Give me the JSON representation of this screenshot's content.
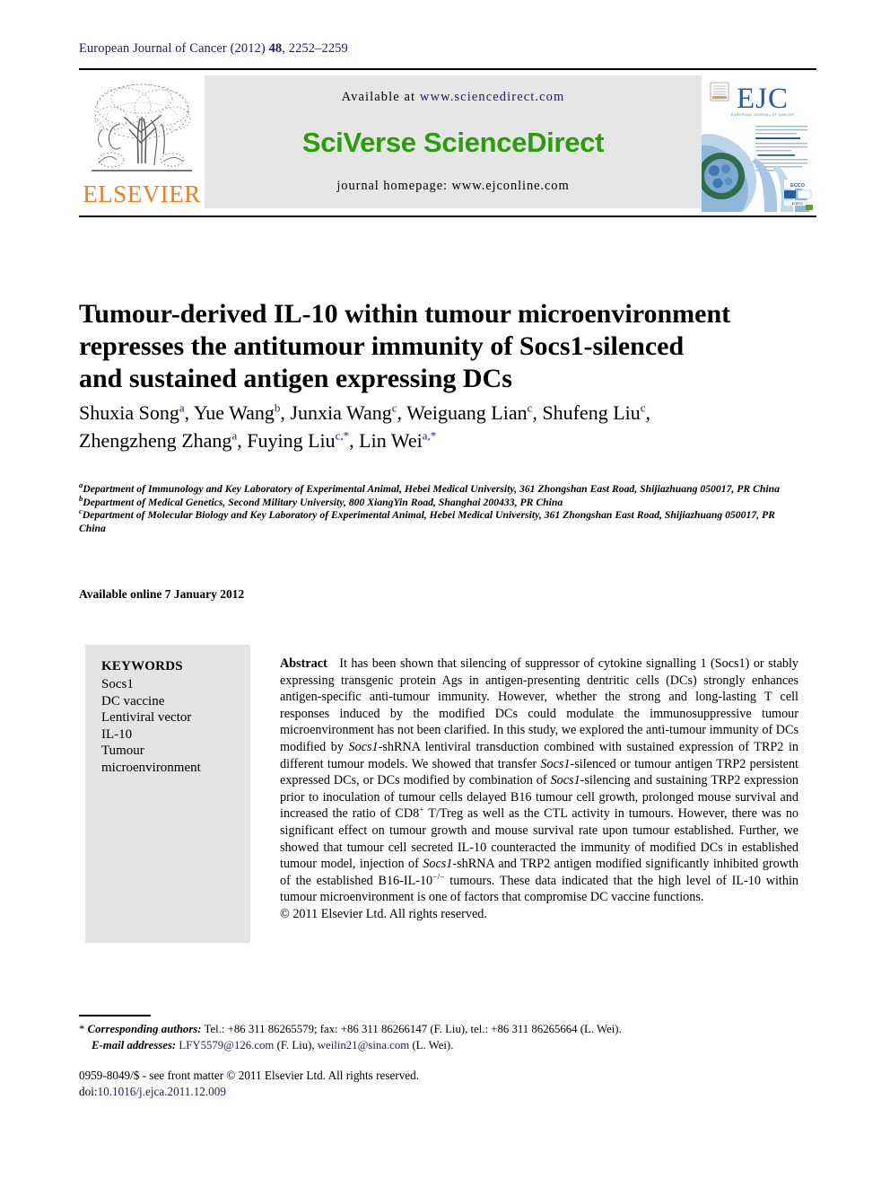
{
  "running_head": {
    "journal": "European Journal of Cancer (2012)",
    "volume": "48",
    "pages": ", 2252–2259"
  },
  "banner": {
    "elsevier_wordmark": "ELSEVIER",
    "available_prefix": "Available at ",
    "available_url": "www.sciencedirect.com",
    "sciverse": "SciVerse ScienceDirect",
    "homepage": "journal homepage: www.ejconline.com",
    "cover_title": "EJC",
    "cover_subtitle": "EUROPEAN JOURNAL OF CANCER"
  },
  "article": {
    "title_line1": "Tumour-derived IL-10 within tumour microenvironment",
    "title_line2": "represses the antitumour immunity of Socs1-silenced",
    "title_line3": "and sustained antigen expressing DCs",
    "available_online": "Available online 7 January 2012"
  },
  "authors": {
    "line1": [
      {
        "name": "Shuxia Song",
        "sup": "a",
        "sep": ", "
      },
      {
        "name": "Yue Wang",
        "sup": "b",
        "sep": ", "
      },
      {
        "name": "Junxia Wang",
        "sup": "c",
        "sep": ", "
      },
      {
        "name": "Weiguang Lian",
        "sup": "c",
        "sep": ", "
      },
      {
        "name": "Shufeng Liu",
        "sup": "c",
        "sep": ","
      }
    ],
    "line2": [
      {
        "name": "Zhengzheng Zhang",
        "sup": "a",
        "sep": ", "
      },
      {
        "name": "Fuying Liu",
        "sup": "c,*",
        "sep": ", "
      },
      {
        "name": "Lin Wei",
        "sup": "a,*",
        "sep": ""
      }
    ]
  },
  "affiliations": [
    {
      "mark": "a",
      "text": "Department of Immunology and Key Laboratory of Experimental Animal, Hebei Medical University, 361 Zhongshan East Road, Shijiazhuang 050017, PR China"
    },
    {
      "mark": "b",
      "text": "Department of Medical Genetics, Second Military University, 800 XiangYin Road, Shanghai 200433, PR China"
    },
    {
      "mark": "c",
      "text": "Department of Molecular Biology and Key Laboratory of Experimental Animal, Hebei Medical University, 361 Zhongshan East Road, Shijiazhuang 050017, PR China"
    }
  ],
  "keywords": {
    "heading": "KEYWORDS",
    "items": [
      "Socs1",
      "DC vaccine",
      "Lentiviral vector",
      "IL-10",
      "Tumour",
      "microenvironment"
    ]
  },
  "abstract": {
    "label": "Abstract",
    "body_parts": [
      {
        "t": "It has been shown that silencing of suppressor of cytokine signalling 1 (Socs1) or stably expressing transgenic protein Ags in antigen-presenting dentritic cells (DCs) strongly enhances antigen-specific anti-tumour immunity. However, whether the strong and long-lasting T cell responses induced by the modified DCs could modulate the immunosuppressive tumour microenvironment has not been clarified. In this study, we explored the anti-tumour immunity of DCs modified by "
      },
      {
        "t": "Socs1",
        "i": true
      },
      {
        "t": "-shRNA lentiviral transduction combined with sustained expression of TRP2 in different tumour models. We showed that transfer "
      },
      {
        "t": "Socs1",
        "i": true
      },
      {
        "t": "-silenced or tumour antigen TRP2 persistent expressed DCs, or DCs modified by combination of "
      },
      {
        "t": "Socs1",
        "i": true
      },
      {
        "t": "-silencing and sustaining TRP2 expression prior to inoculation of tumour cells delayed B16 tumour cell growth, prolonged mouse survival and increased the ratio of CD8"
      },
      {
        "t": "+",
        "sup": true
      },
      {
        "t": " T/Treg as well as the CTL activity in tumours. However, there was no significant effect on tumour growth and mouse survival rate upon tumour established. Further, we showed that tumour cell secreted IL-10 counteracted the immunity of modified DCs in established tumour model, injection of "
      },
      {
        "t": "Socs1",
        "i": true
      },
      {
        "t": "-shRNA and TRP2 antigen modified significantly inhibited growth of the established B16-IL-10"
      },
      {
        "t": "−/−",
        "sup": true
      },
      {
        "t": " tumours. These data indicated that the high level of IL-10 within tumour microenvironment is one of factors that compromise DC vaccine functions."
      }
    ],
    "copyright": "© 2011 Elsevier Ltd. All rights reserved."
  },
  "footnote": {
    "star": "*",
    "corresponding_label": "Corresponding authors:",
    "corresponding_text": " Tel.: +86 311 86265579; fax: +86 311 86266147 (F. Liu), tel.: +86 311 86265664 (L. Wei).",
    "email_label": "E-mail addresses:",
    "email1": "LFY5579@126.com",
    "email1_owner": " (F. Liu), ",
    "email2": "weilin21@sina.com",
    "email2_owner": " (L. Wei)."
  },
  "bottom": {
    "issn_line": "0959-8049/$ - see front matter © 2011 Elsevier Ltd. All rights reserved.",
    "doi_prefix": "doi:",
    "doi_value": "10.1016/j.ejca.2011.12.009"
  },
  "colors": {
    "navy": "#1d1d66",
    "elsevier_orange": "#f07d20",
    "sciencedirect_green": "#2a9d0a",
    "keyword_box_gray": "#e4e4e4",
    "banner_gray": "#e6e6e6"
  }
}
